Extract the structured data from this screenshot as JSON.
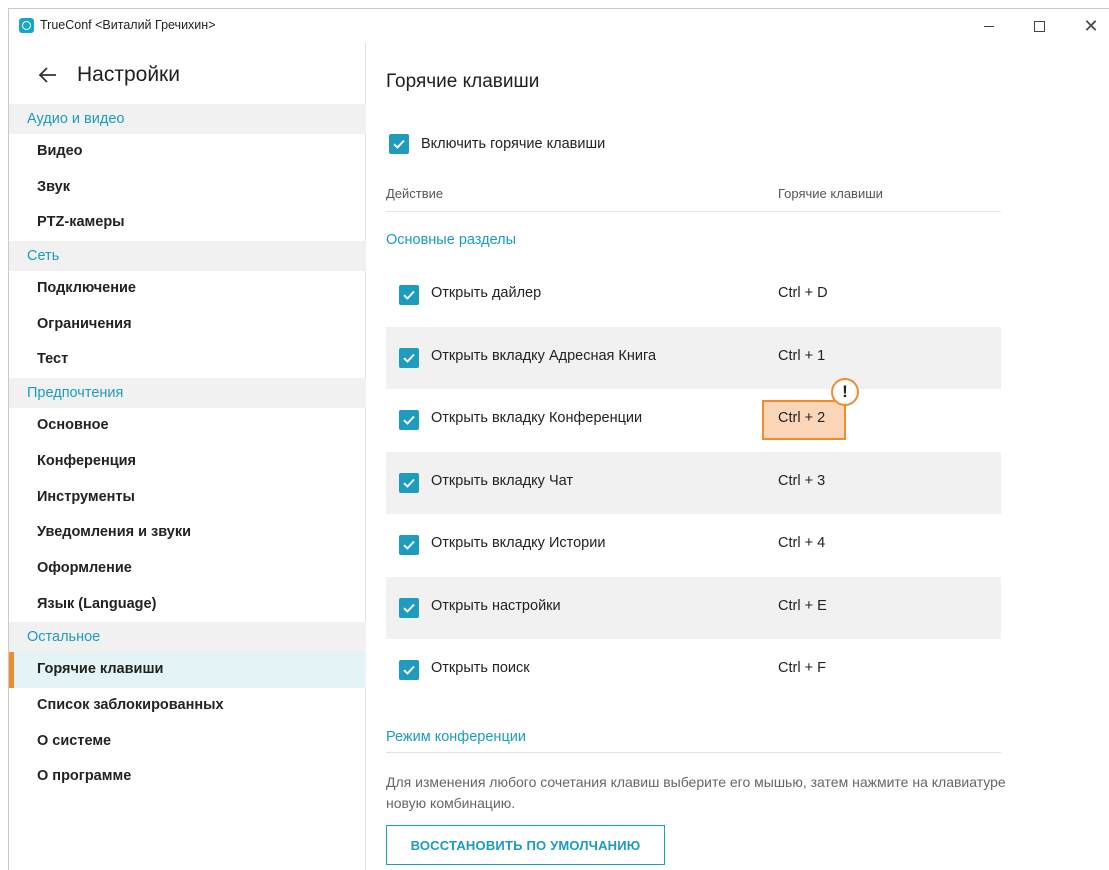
{
  "window": {
    "title": "TrueConf <Виталий Гречихин>",
    "icon": "trueconf-app-icon",
    "controls": {
      "minimize": "minimize-icon",
      "maximize": "maximize-icon",
      "close": "✕"
    }
  },
  "sidebar": {
    "title": "Настройки",
    "back_icon": "arrow-left-icon",
    "sections": [
      {
        "label": "Аудио и видео",
        "items": [
          "Видео",
          "Звук",
          "PTZ-камеры"
        ]
      },
      {
        "label": "Сеть",
        "items": [
          "Подключение",
          "Ограничения",
          "Тест"
        ]
      },
      {
        "label": "Предпочтения",
        "items": [
          "Основное",
          "Конференция",
          "Инструменты",
          "Уведомления и звуки",
          "Оформление",
          "Язык (Language)"
        ]
      },
      {
        "label": "Остальное",
        "items": [
          "Горячие клавиши",
          "Список заблокированных",
          "О системе",
          "О программе"
        ]
      }
    ],
    "active_item": "Горячие клавиши"
  },
  "main": {
    "title": "Горячие клавиши",
    "enable_label": "Включить горячие клавиши",
    "enable_checked": true,
    "columns": {
      "action": "Действие",
      "keys": "Горячие клавиши"
    },
    "section_main": "Основные разделы",
    "rows": [
      {
        "label": "Открыть дайлер",
        "keys": "Ctrl + D",
        "checked": true
      },
      {
        "label": "Открыть вкладку Адресная Книга",
        "keys": "Ctrl + 1",
        "checked": true
      },
      {
        "label": "Открыть вкладку Конференции",
        "keys": "Ctrl + 2",
        "checked": true,
        "highlighted": true
      },
      {
        "label": "Открыть вкладку Чат",
        "keys": "Ctrl + 3",
        "checked": true
      },
      {
        "label": "Открыть вкладку Истории",
        "keys": "Ctrl + 4",
        "checked": true
      },
      {
        "label": "Открыть настройки",
        "keys": "Ctrl + E",
        "checked": true
      },
      {
        "label": "Открыть поиск",
        "keys": "Ctrl + F",
        "checked": true
      }
    ],
    "warning_mark": "!",
    "section_conference": "Режим конференции",
    "hint": "Для изменения любого сочетания клавиш выберите его мышью, затем нажмите на клавиатуре новую комбинацию.",
    "restore_button": "ВОССТАНОВИТЬ ПО УМОЛЧАНИЮ"
  },
  "colors": {
    "accent": "#1a9cbc",
    "checkbox": "#1e9cbf",
    "highlight_border": "#f08c2e",
    "highlight_fill": "#fbd5b8",
    "active_item_bg": "#e4f3f5",
    "category_bg": "#f1f1f1"
  }
}
